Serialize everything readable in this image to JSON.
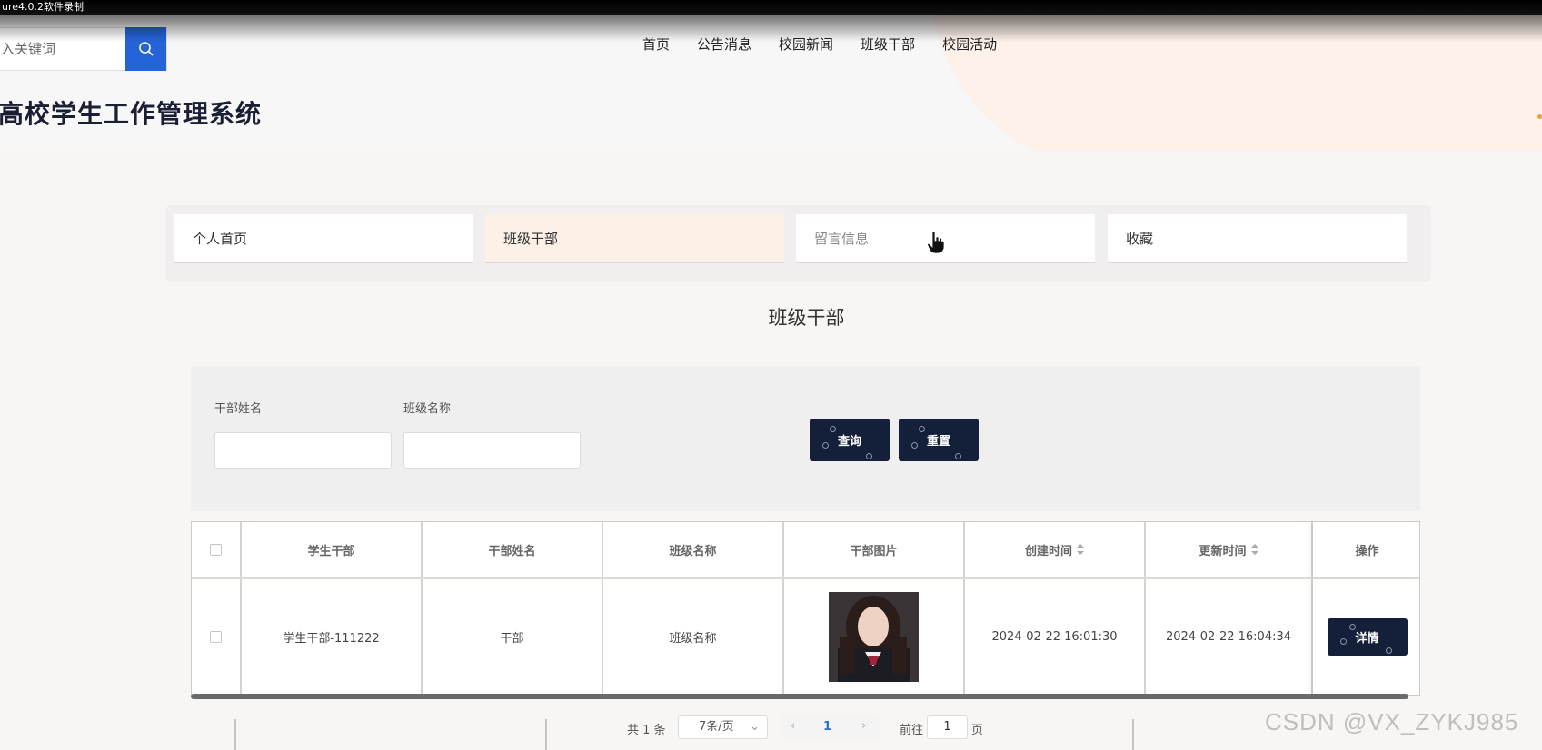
{
  "recorder": {
    "text": "ure4.0.2软件录制"
  },
  "header": {
    "search_placeholder": "入关键词",
    "site_title": "高校学生工作管理系统",
    "nav": [
      "首页",
      "公告消息",
      "校园新闻",
      "班级干部",
      "校园活动"
    ]
  },
  "tabs": [
    {
      "label": "个人首页",
      "active": false
    },
    {
      "label": "班级干部",
      "active": true
    },
    {
      "label": "留言信息",
      "active": false
    },
    {
      "label": "收藏",
      "active": false
    }
  ],
  "section": {
    "title": "班级干部"
  },
  "filters": {
    "name_label": "干部姓名",
    "class_label": "班级名称",
    "query_label": "查询",
    "reset_label": "重置"
  },
  "table": {
    "headers": [
      "学生干部",
      "干部姓名",
      "班级名称",
      "干部图片",
      "创建时间",
      "更新时间",
      "操作"
    ],
    "rows": [
      {
        "student_cadre": "学生干部-111222",
        "cadre_name": "干部",
        "class_name": "班级名称",
        "created": "2024-02-22 16:01:30",
        "updated": "2024-02-22 16:04:34",
        "action": "详情"
      }
    ]
  },
  "pagination": {
    "total": "共 1 条",
    "page_size": "7条/页",
    "prev": "‹",
    "current": "1",
    "next": "›",
    "goto": "前往",
    "jump_value": "1",
    "page_unit": "页"
  },
  "watermark": "CSDN @VX_ZYKJ985",
  "colors": {
    "search_btn": "#2563d9",
    "dark_btn": "#14203a",
    "active_tab": "#fdf0e7",
    "page_link": "#2c6fd6"
  }
}
